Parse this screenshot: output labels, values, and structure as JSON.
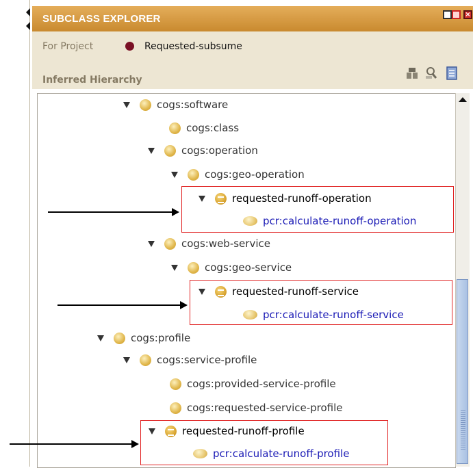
{
  "panel": {
    "title": "SUBCLASS EXPLORER",
    "project_label": "For Project",
    "project_name": "Requested-subsume",
    "hierarchy_label": "Inferred Hierarchy"
  },
  "toolbar_icons": [
    "hierarchy-tool-icon",
    "find-icon",
    "document-icon"
  ],
  "window_buttons": [
    "restore-icon",
    "minimize-icon",
    "maximize-icon",
    "close-icon"
  ],
  "tree": [
    {
      "label": "cogs:software",
      "kind": "class",
      "expanded": true
    },
    {
      "label": "cogs:class",
      "kind": "class"
    },
    {
      "label": "cogs:operation",
      "kind": "class",
      "expanded": true
    },
    {
      "label": "cogs:geo-operation",
      "kind": "class",
      "expanded": true
    },
    {
      "label": "requested-runoff-operation",
      "kind": "defined",
      "expanded": true
    },
    {
      "label": "pcr:calculate-runoff-operation",
      "kind": "instance"
    },
    {
      "label": "cogs:web-service",
      "kind": "class",
      "expanded": true
    },
    {
      "label": "cogs:geo-service",
      "kind": "class",
      "expanded": true
    },
    {
      "label": "requested-runoff-service",
      "kind": "defined",
      "expanded": true
    },
    {
      "label": "pcr:calculate-runoff-service",
      "kind": "instance"
    },
    {
      "label": "cogs:profile",
      "kind": "class",
      "expanded": true
    },
    {
      "label": "cogs:service-profile",
      "kind": "class",
      "expanded": true
    },
    {
      "label": "cogs:provided-service-profile",
      "kind": "class"
    },
    {
      "label": "cogs:requested-service-profile",
      "kind": "class"
    },
    {
      "label": "requested-runoff-profile",
      "kind": "defined",
      "expanded": true
    },
    {
      "label": "pcr:calculate-runoff-profile",
      "kind": "instance"
    }
  ],
  "colors": {
    "title_bar": "#d69b45",
    "header_bg": "#ede6d3",
    "highlight_box": "#e02020",
    "instance_text": "#1a1ab5"
  }
}
